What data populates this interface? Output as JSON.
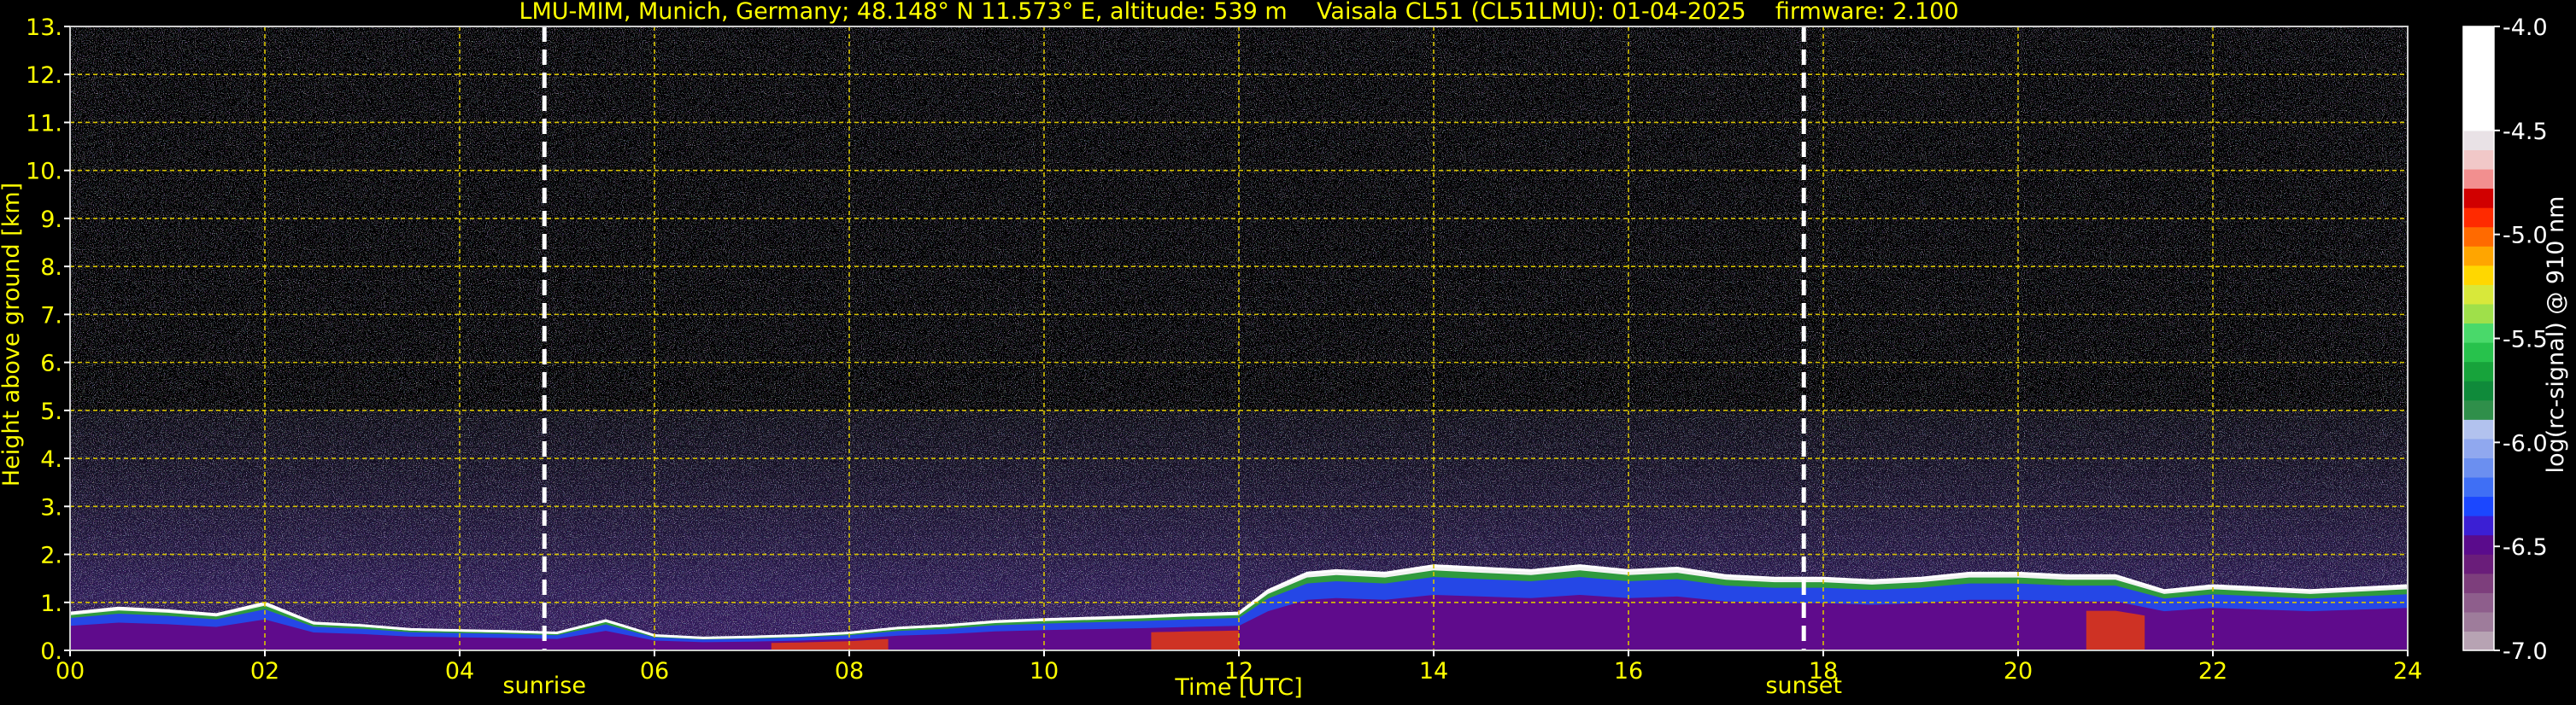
{
  "chart_data": {
    "type": "heatmap",
    "title": "LMU-MIM, Munich, Germany; 48.148° N 11.573° E, altitude: 539 m    Vaisala CL51 (CL51LMU): 01-04-2025    firmware: 2.100",
    "xlabel": "Time [UTC]",
    "ylabel": "Height above ground [km]",
    "xlim": [
      0,
      24
    ],
    "ylim": [
      0,
      13
    ],
    "x_ticks": [
      "00",
      "02",
      "04",
      "06",
      "08",
      "10",
      "12",
      "14",
      "16",
      "18",
      "20",
      "22",
      "24"
    ],
    "y_ticks": [
      "0.",
      "1.",
      "2.",
      "3.",
      "4.",
      "5.",
      "6.",
      "7.",
      "8.",
      "9.",
      "10.",
      "11.",
      "12.",
      "13."
    ],
    "grid": true,
    "markers": [
      {
        "label": "sunrise",
        "time": 4.87
      },
      {
        "label": "sunset",
        "time": 17.8
      }
    ],
    "colorbar": {
      "label": "log(rc-signal) @ 910 nm",
      "range": [
        -7.0,
        -4.0
      ],
      "ticks": [
        "-4.0",
        "-4.5",
        "-5.0",
        "-5.5",
        "-6.0",
        "-6.5",
        "-7.0"
      ],
      "colors": [
        "#b7a3b3",
        "#9e7c9b",
        "#8e5e8c",
        "#7d3e7c",
        "#6a1d7a",
        "#5a0b8c",
        "#3b1fd4",
        "#1b47ff",
        "#3f6ff5",
        "#6b8ff0",
        "#90a8ef",
        "#b2c2ee",
        "#2f8f4a",
        "#0f8a3a",
        "#17a33b",
        "#27c24c",
        "#49d96a",
        "#9fe04a",
        "#d8e83a",
        "#ffd700",
        "#ffa500",
        "#ff6a00",
        "#ff2a00",
        "#d10000",
        "#f28f8f",
        "#f1c8c8",
        "#e9e2e6",
        "#ffffff"
      ]
    },
    "boundary_layer": {
      "time": [
        0,
        0.5,
        1,
        1.5,
        2,
        2.5,
        3,
        3.5,
        4,
        4.5,
        5,
        5.5,
        6,
        6.5,
        7,
        7.5,
        8,
        8.5,
        9,
        9.5,
        10,
        10.5,
        11,
        11.5,
        12,
        12.3,
        12.7,
        13,
        13.5,
        14,
        14.5,
        15,
        15.5,
        16,
        16.5,
        17,
        17.5,
        18,
        18.5,
        19,
        19.5,
        20,
        20.5,
        21,
        21.5,
        22,
        22.5,
        23,
        23.5,
        24
      ],
      "top_height_km": [
        0.75,
        0.85,
        0.8,
        0.72,
        0.95,
        0.55,
        0.5,
        0.42,
        0.4,
        0.38,
        0.35,
        0.6,
        0.3,
        0.25,
        0.27,
        0.3,
        0.35,
        0.45,
        0.5,
        0.58,
        0.62,
        0.65,
        0.68,
        0.72,
        0.75,
        1.2,
        1.55,
        1.6,
        1.55,
        1.7,
        1.65,
        1.6,
        1.7,
        1.6,
        1.65,
        1.5,
        1.45,
        1.45,
        1.4,
        1.45,
        1.55,
        1.55,
        1.5,
        1.5,
        1.2,
        1.3,
        1.25,
        1.2,
        1.25,
        1.3
      ]
    }
  }
}
